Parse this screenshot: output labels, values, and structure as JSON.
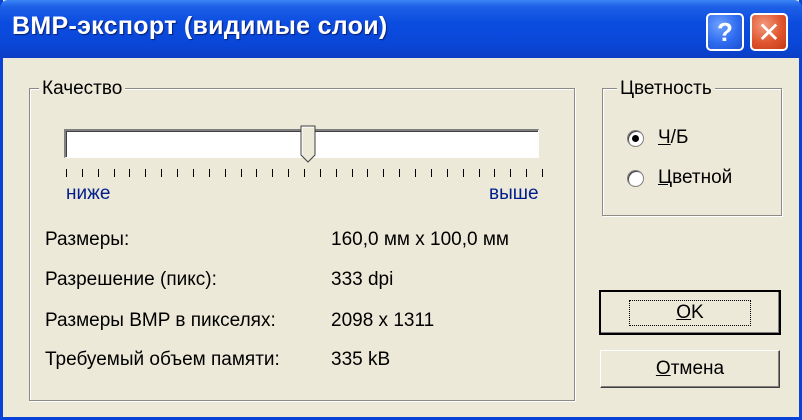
{
  "window": {
    "title": "BMP-экспорт (видимые слои)",
    "help_label": "?",
    "close_label": "✕"
  },
  "quality": {
    "legend": "Качество",
    "slider_value_fraction": 0.48,
    "tick_count": 31,
    "low_label": "ниже",
    "high_label": "выше"
  },
  "info": [
    {
      "label": "Размеры:",
      "value": "160,0 мм x 100,0 мм"
    },
    {
      "label": "Разрешение (пикс):",
      "value": "333 dpi"
    },
    {
      "label": "Размеры BMP в пикселях:",
      "value": "2098 x 1311"
    },
    {
      "label": "Требуемый объем памяти:",
      "value": "335 kB"
    }
  ],
  "color": {
    "legend": "Цветность",
    "options": [
      {
        "label_accel": "Ч",
        "label_rest": "/Б",
        "checked": true
      },
      {
        "label_accel": "Ц",
        "label_rest": "ветной",
        "checked": false
      }
    ]
  },
  "buttons": {
    "ok_accel": "О",
    "ok_rest": "K",
    "cancel_accel": "О",
    "cancel_rest": "тмена"
  },
  "colors": {
    "titlebar": "#0a47d8",
    "dialog_bg": "#ece9d8",
    "scale_text": "#001e8c",
    "close_button": "#e0552f",
    "help_button": "#2f6cf0"
  }
}
